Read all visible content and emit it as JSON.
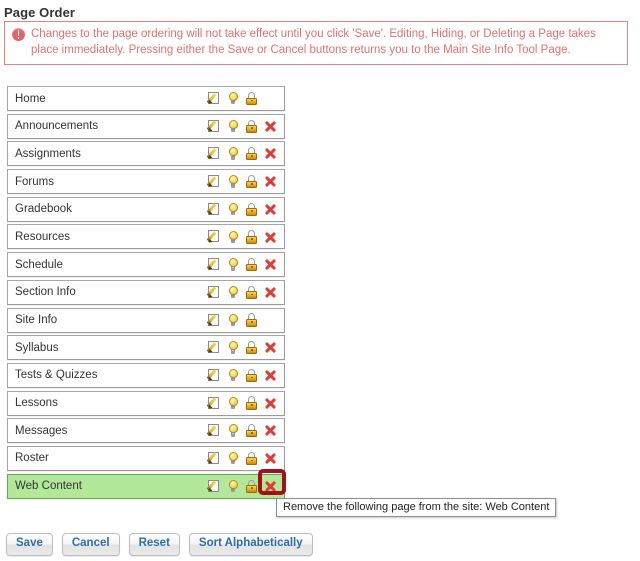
{
  "page": {
    "title": "Page Order"
  },
  "alert": {
    "icon": "alert-circle-icon",
    "message": "Changes to the page ordering will not take effect until you click 'Save'. Editing, Hiding, or Deleting a Page takes place immediately. Pressing either the Save or Cancel buttons returns you to the Main Site Info Tool Page."
  },
  "icons": {
    "edit": "pencil-edit-icon",
    "bulb": "lightbulb-icon",
    "lock": "padlock-icon",
    "delete": "red-x-delete-icon"
  },
  "page_list": [
    {
      "label": "Home",
      "deletable": false,
      "selected": false
    },
    {
      "label": "Announcements",
      "deletable": true,
      "selected": false
    },
    {
      "label": "Assignments",
      "deletable": true,
      "selected": false
    },
    {
      "label": "Forums",
      "deletable": true,
      "selected": false
    },
    {
      "label": "Gradebook",
      "deletable": true,
      "selected": false
    },
    {
      "label": "Resources",
      "deletable": true,
      "selected": false
    },
    {
      "label": "Schedule",
      "deletable": true,
      "selected": false
    },
    {
      "label": "Section Info",
      "deletable": true,
      "selected": false
    },
    {
      "label": "Site Info",
      "deletable": false,
      "selected": false
    },
    {
      "label": "Syllabus",
      "deletable": true,
      "selected": false
    },
    {
      "label": "Tests & Quizzes",
      "deletable": true,
      "selected": false
    },
    {
      "label": "Lessons",
      "deletable": true,
      "selected": false
    },
    {
      "label": "Messages",
      "deletable": true,
      "selected": false
    },
    {
      "label": "Roster",
      "deletable": true,
      "selected": false
    },
    {
      "label": "Web Content",
      "deletable": true,
      "selected": true
    }
  ],
  "tooltip": {
    "text": "Remove the following page from the site: Web Content"
  },
  "buttons": [
    {
      "label": "Save"
    },
    {
      "label": "Cancel"
    },
    {
      "label": "Reset"
    },
    {
      "label": "Sort Alphabetically"
    }
  ],
  "colors": {
    "alert_border": "#e8837f",
    "alert_text": "#e0736f",
    "selected_row_bg": "#b3e89b",
    "selected_row_border": "#6aa84f",
    "annotation": "#9e1218",
    "button_text": "#2b6cb0",
    "delete_icon": "#e03b34"
  }
}
